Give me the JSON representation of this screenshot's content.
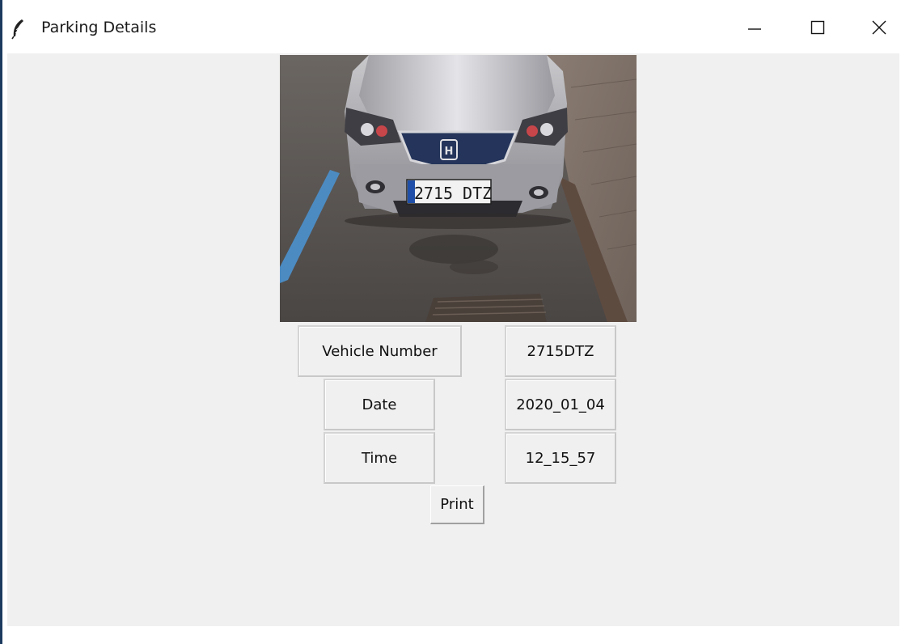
{
  "window": {
    "title": "Parking Details",
    "icon": "feather-icon"
  },
  "title_buttons": {
    "minimize_icon": "minimize-icon",
    "maximize_icon": "maximize-icon",
    "close_icon": "close-icon"
  },
  "photo": {
    "plate_text": "2715 DTZ",
    "description": "car-front-photo"
  },
  "details": {
    "vehicle_number_label": "Vehicle Number",
    "vehicle_number_value": "2715DTZ",
    "date_label": "Date",
    "date_value": "2020_01_04",
    "time_label": "Time",
    "time_value": "12_15_57"
  },
  "actions": {
    "print_label": "Print"
  },
  "colors": {
    "client_bg": "#f0f0f0",
    "titlebar_bg": "#ffffff",
    "plate_blue": "#1f4fa8"
  }
}
